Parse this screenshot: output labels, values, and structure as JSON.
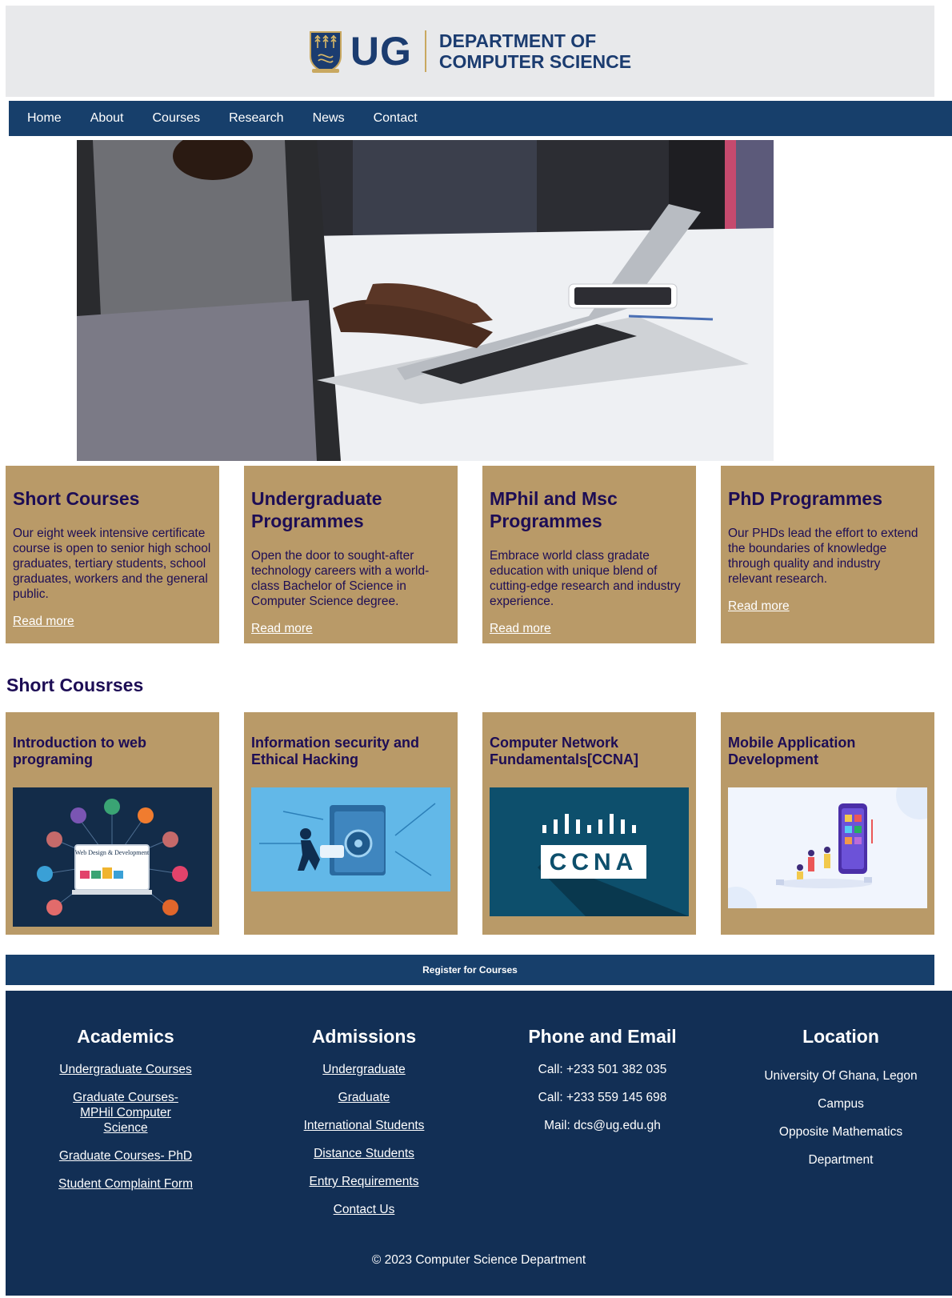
{
  "header": {
    "logo_short": "UG",
    "dept_line1": "DEPARTMENT OF",
    "dept_line2": "COMPUTER SCIENCE"
  },
  "nav": {
    "items": [
      "Home",
      "About",
      "Courses",
      "Research",
      "News",
      "Contact"
    ]
  },
  "programmes": [
    {
      "title": "Short Courses",
      "text": "Our eight week intensive certificate course is open to senior high school graduates, tertiary students, school graduates, workers and the general public.",
      "link": "Read more"
    },
    {
      "title": "Undergraduate Programmes",
      "text": "Open the door to sought-after technology careers with a world-class Bachelor of Science in Computer Science degree.",
      "link": "Read more"
    },
    {
      "title": "MPhil and Msc Programmes",
      "text": "Embrace world class gradate education with unique blend of cutting-edge research and industry experience.",
      "link": "Read more"
    },
    {
      "title": "PhD Programmes",
      "text": "Our PHDs lead the effort to extend the boundaries of knowledge through quality and industry relevant research.",
      "link": "Read more"
    }
  ],
  "short_courses_title": "Short Cousrses",
  "short_courses": [
    {
      "title": "Introduction to web programing",
      "image_text": "Web Design & Development"
    },
    {
      "title": "Information security and Ethical Hacking"
    },
    {
      "title": "Computer Network Fundamentals[CCNA]",
      "image_text": "CCNA"
    },
    {
      "title": "Mobile Application Development"
    }
  ],
  "register_label": "Register for Courses",
  "footer": {
    "academics": {
      "title": "Academics",
      "links": [
        "Undergraduate Courses",
        "Graduate Courses- MPHil Computer Science",
        "Graduate Courses- PhD",
        "Student Complaint Form"
      ]
    },
    "admissions": {
      "title": "Admissions",
      "links": [
        "Undergraduate",
        "Graduate",
        "International Students",
        "Distance Students",
        "Entry Requirements",
        "Contact Us"
      ]
    },
    "contact": {
      "title": "Phone and Email",
      "lines": [
        "Call: +233 501 382 035",
        "Call: +233 559 145 698",
        "Mail: dcs@ug.edu.gh"
      ]
    },
    "location": {
      "title": "Location",
      "lines": [
        "University Of Ghana, Legon",
        "Campus",
        "Opposite Mathematics",
        "Department"
      ]
    },
    "copyright": "© 2023 Computer Science Department"
  },
  "colors": {
    "nav_blue": "#173f6b",
    "footer_blue": "#122f55",
    "card_tan": "#b99a68",
    "heading_purple": "#1d0d55",
    "header_gray": "#e8e9eb"
  }
}
